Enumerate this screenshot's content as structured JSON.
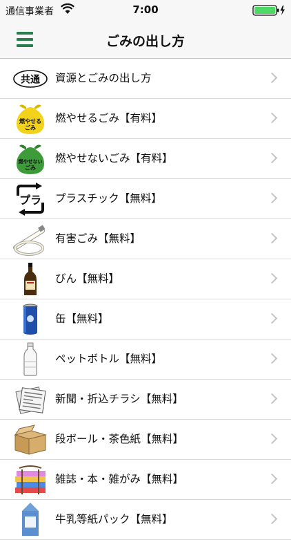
{
  "status_bar": {
    "carrier": "通信事業者",
    "time": "7:00"
  },
  "nav": {
    "title": "ごみの出し方"
  },
  "items": [
    {
      "label": "資源とごみの出し方",
      "icon_text": "共通"
    },
    {
      "label": "燃やせるごみ【有料】",
      "icon_text_1": "燃やせる",
      "icon_text_2": "ごみ"
    },
    {
      "label": "燃やせないごみ【有料】",
      "icon_text_1": "燃やせない",
      "icon_text_2": "ごみ"
    },
    {
      "label": "プラスチック【無料】"
    },
    {
      "label": "有害ごみ【無料】"
    },
    {
      "label": "びん【無料】"
    },
    {
      "label": "缶【無料】"
    },
    {
      "label": "ペットボトル【無料】"
    },
    {
      "label": "新聞・折込チラシ【無料】"
    },
    {
      "label": "段ボール・茶色紙【無料】"
    },
    {
      "label": "雑誌・本・雑がみ【無料】"
    },
    {
      "label": "牛乳等紙パック【無料】"
    }
  ],
  "colors": {
    "accent_green": "#2a7d4f",
    "bag_yellow": "#f2d21b",
    "bag_green": "#3e9b3a"
  }
}
